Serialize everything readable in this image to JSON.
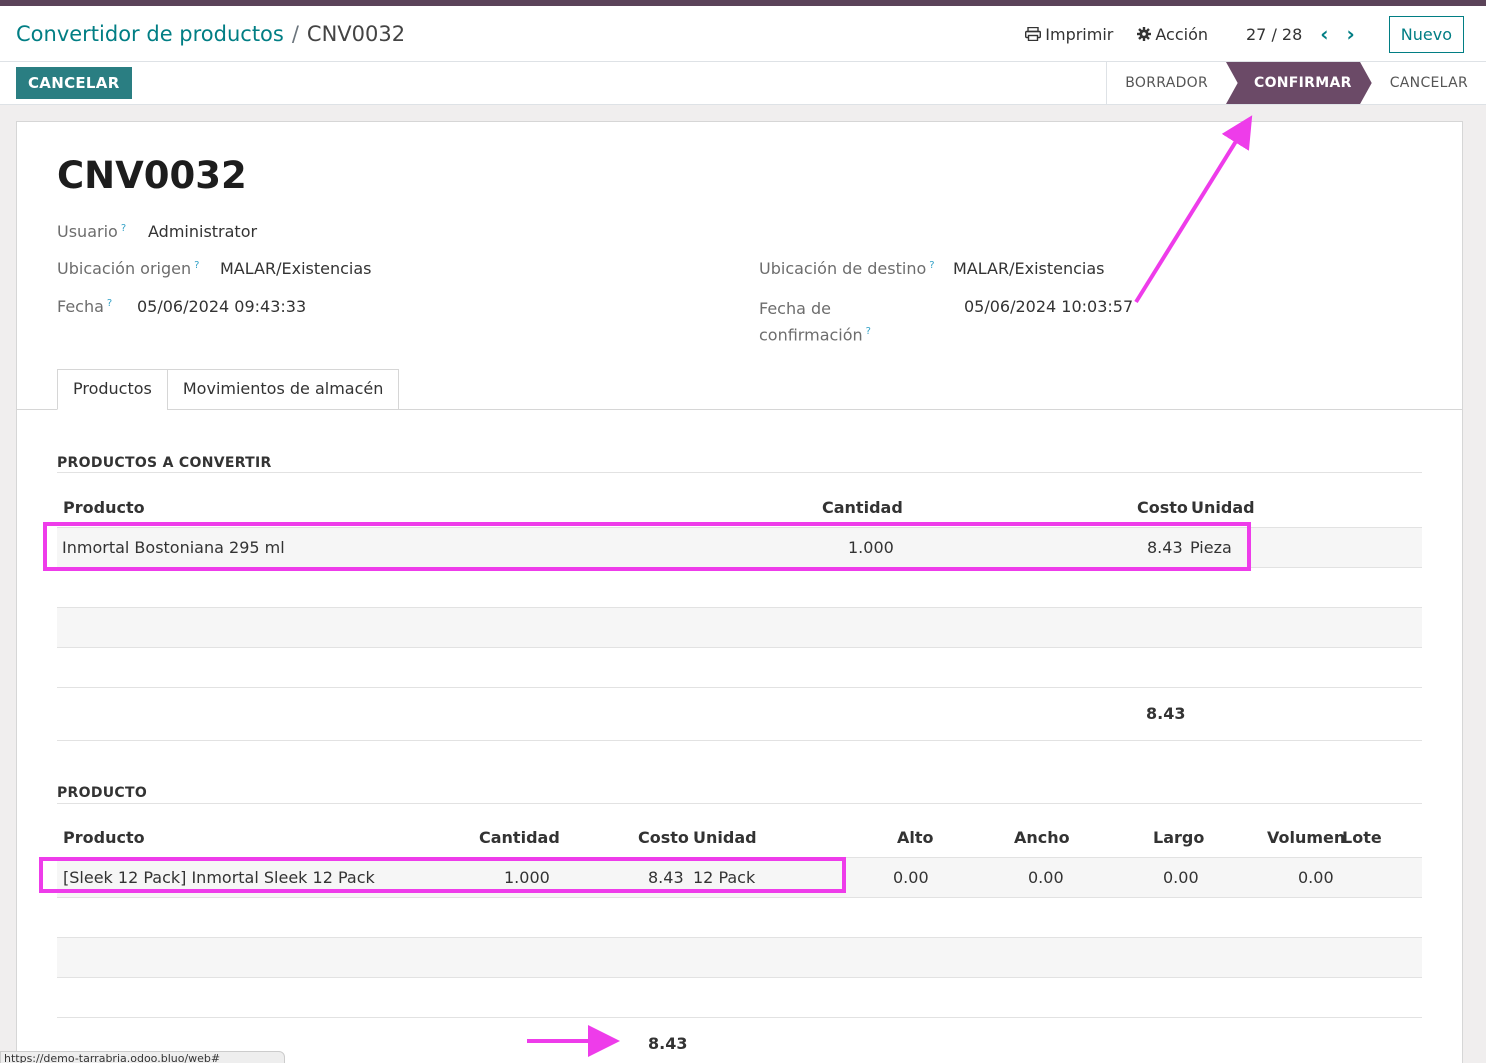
{
  "breadcrumb": {
    "parent": "Convertidor de productos",
    "current": "CNV0032"
  },
  "actions": {
    "print": "Imprimir",
    "action": "Acción"
  },
  "pager": {
    "value": "27 / 28"
  },
  "buttons": {
    "new": "Nuevo",
    "cancel": "CANCELAR"
  },
  "stages": {
    "draft": "BORRADOR",
    "confirm": "CONFIRMAR",
    "cancel": "CANCELAR"
  },
  "record": {
    "name": "CNV0032",
    "user_label": "Usuario",
    "user": "Administrator",
    "origin_label": "Ubicación origen",
    "origin": "MALAR/Existencias",
    "date_label": "Fecha",
    "date": "05/06/2024 09:43:33",
    "dest_label": "Ubicación de destino",
    "dest": "MALAR/Existencias",
    "confirm_label_1": "Fecha de",
    "confirm_label_2": "confirmación",
    "confirm_date": "05/06/2024 10:03:57"
  },
  "tabs": [
    "Productos",
    "Movimientos de almacén"
  ],
  "section1": {
    "title": "PRODUCTOS A CONVERTIR",
    "headers": [
      "Producto",
      "Cantidad",
      "Costo",
      "Unidad"
    ],
    "row": {
      "product": "Inmortal Bostoniana 295 ml",
      "qty": "1.000",
      "cost": "8.43",
      "unit": "Pieza"
    },
    "total": "8.43"
  },
  "section2": {
    "title": "PRODUCTO",
    "headers": [
      "Producto",
      "Cantidad",
      "Costo",
      "Unidad",
      "Alto",
      "Ancho",
      "Largo",
      "Volumen",
      "Lote"
    ],
    "row": {
      "product": "[Sleek 12 Pack] Inmortal Sleek 12 Pack",
      "qty": "1.000",
      "cost": "8.43",
      "unit": "12 Pack",
      "alto": "0.00",
      "ancho": "0.00",
      "largo": "0.00",
      "volumen": "0.00"
    },
    "total": "8.43"
  },
  "status_url": "https://demo-tarrabria.odoo.bluo/web#",
  "colors": {
    "accent": "#017e84",
    "stage_active": "#6b4a67",
    "annotation": "#ee3cea"
  }
}
